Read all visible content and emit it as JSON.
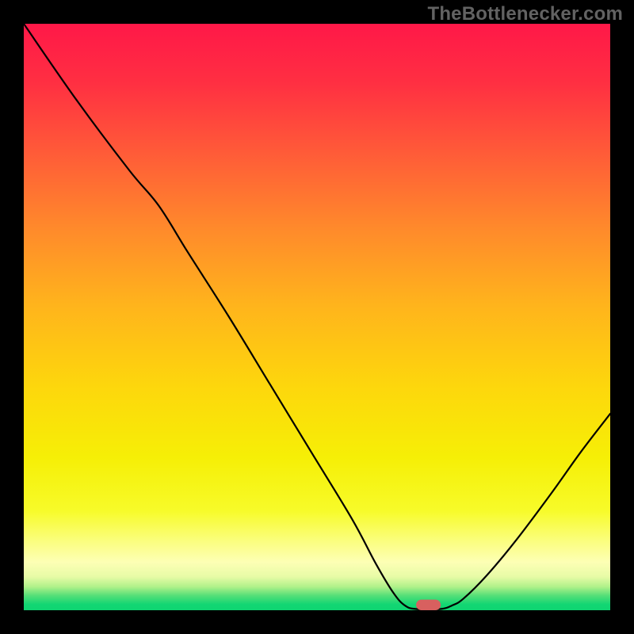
{
  "watermark": {
    "text": "TheBottlenecker.com"
  },
  "chart_data": {
    "type": "line",
    "title": "",
    "xlabel": "",
    "ylabel": "",
    "xlim": [
      0,
      100
    ],
    "ylim": [
      0,
      100
    ],
    "grid": false,
    "background_gradient": {
      "stops": [
        {
          "offset": 0.0,
          "color": "#ff1848"
        },
        {
          "offset": 0.1,
          "color": "#ff2f42"
        },
        {
          "offset": 0.22,
          "color": "#ff5b38"
        },
        {
          "offset": 0.35,
          "color": "#ff8a2b"
        },
        {
          "offset": 0.48,
          "color": "#ffb41c"
        },
        {
          "offset": 0.62,
          "color": "#fdd70c"
        },
        {
          "offset": 0.74,
          "color": "#f6ef06"
        },
        {
          "offset": 0.83,
          "color": "#f7fb29"
        },
        {
          "offset": 0.885,
          "color": "#fbfe83"
        },
        {
          "offset": 0.918,
          "color": "#fdffb5"
        },
        {
          "offset": 0.943,
          "color": "#e7fba6"
        },
        {
          "offset": 0.96,
          "color": "#b0f18a"
        },
        {
          "offset": 0.975,
          "color": "#55df78"
        },
        {
          "offset": 0.99,
          "color": "#12d673"
        },
        {
          "offset": 1.0,
          "color": "#0fd572"
        }
      ]
    },
    "series": [
      {
        "name": "bottleneck-curve",
        "stroke": "#000000",
        "points": [
          {
            "x": 0.0,
            "y": 100.0
          },
          {
            "x": 9.0,
            "y": 87.0
          },
          {
            "x": 18.0,
            "y": 75.0
          },
          {
            "x": 23.0,
            "y": 69.0
          },
          {
            "x": 28.0,
            "y": 61.0
          },
          {
            "x": 35.0,
            "y": 50.0
          },
          {
            "x": 42.0,
            "y": 38.5
          },
          {
            "x": 49.0,
            "y": 27.0
          },
          {
            "x": 56.0,
            "y": 15.5
          },
          {
            "x": 60.0,
            "y": 8.0
          },
          {
            "x": 63.0,
            "y": 3.0
          },
          {
            "x": 65.0,
            "y": 0.8
          },
          {
            "x": 67.0,
            "y": 0.2
          },
          {
            "x": 71.0,
            "y": 0.2
          },
          {
            "x": 73.0,
            "y": 0.8
          },
          {
            "x": 75.0,
            "y": 2.0
          },
          {
            "x": 79.0,
            "y": 6.0
          },
          {
            "x": 84.0,
            "y": 12.0
          },
          {
            "x": 90.0,
            "y": 20.0
          },
          {
            "x": 95.0,
            "y": 27.0
          },
          {
            "x": 100.0,
            "y": 33.5
          }
        ]
      }
    ],
    "marker": {
      "name": "optimal-marker",
      "shape": "rounded-rect",
      "x": 69.0,
      "y": 0.9,
      "width": 4.2,
      "height": 1.8,
      "fill": "#d8605f"
    }
  }
}
